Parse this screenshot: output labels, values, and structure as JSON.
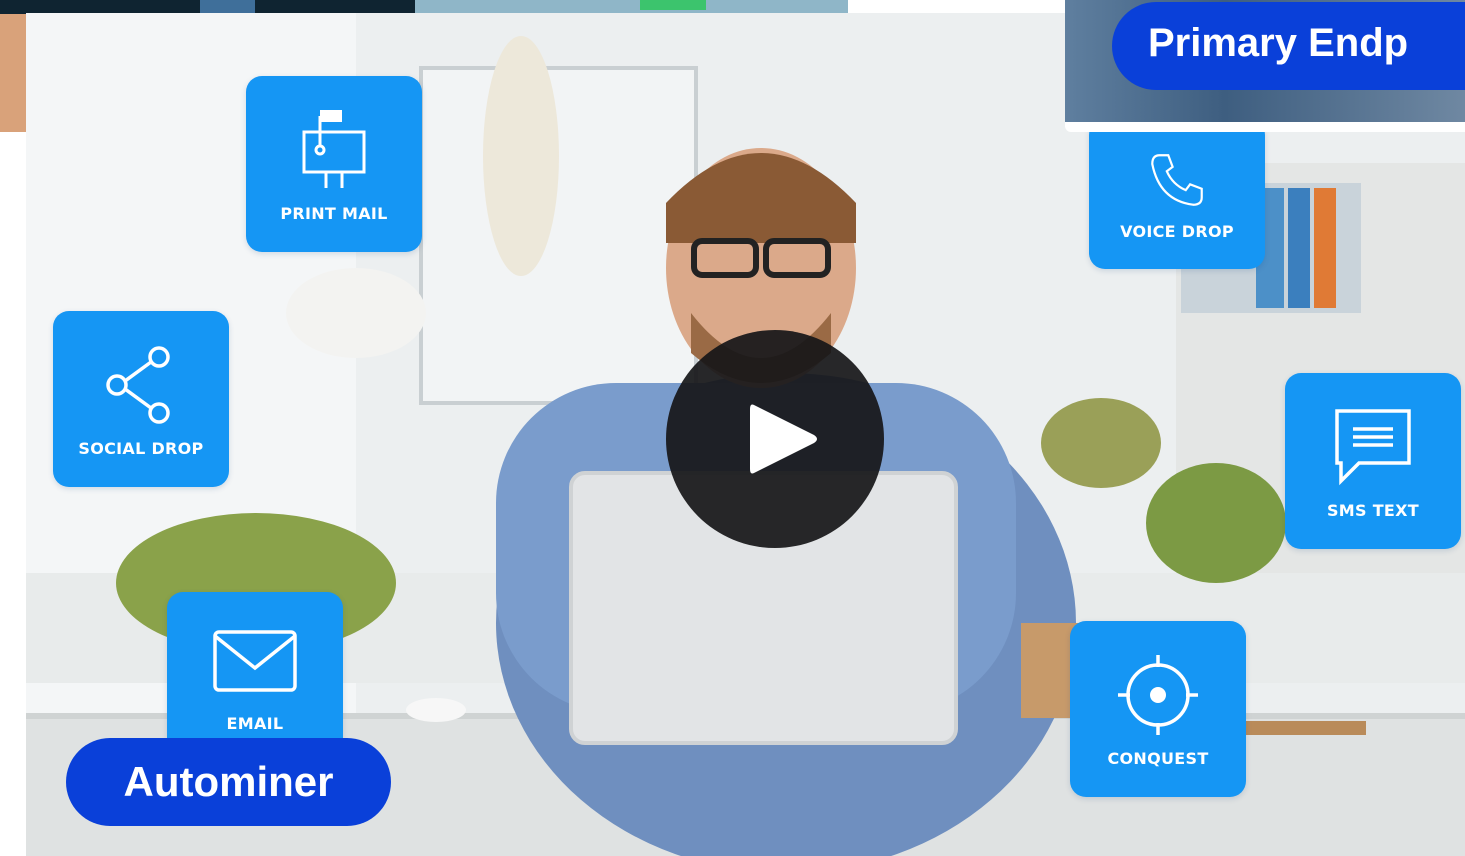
{
  "video": {
    "play_button_icon": "play-icon",
    "channels": [
      {
        "label": "PRINT MAIL",
        "icon": "mailbox-icon"
      },
      {
        "label": "VOICE DROP",
        "icon": "phone-icon"
      },
      {
        "label": "SOCIAL DROP",
        "icon": "share-icon"
      },
      {
        "label": "SMS TEXT",
        "icon": "chat-message-icon"
      },
      {
        "label": "EMAIL",
        "icon": "envelope-icon"
      },
      {
        "label": "CONQUEST",
        "icon": "target-icon"
      }
    ]
  },
  "cards": {
    "primary_card_label": "Autominer",
    "secondary_card_label": "Primary Endp"
  },
  "colors": {
    "tile_blue": "#1596f4",
    "pill_blue": "#0a40d9",
    "play_bg": "#161618"
  }
}
